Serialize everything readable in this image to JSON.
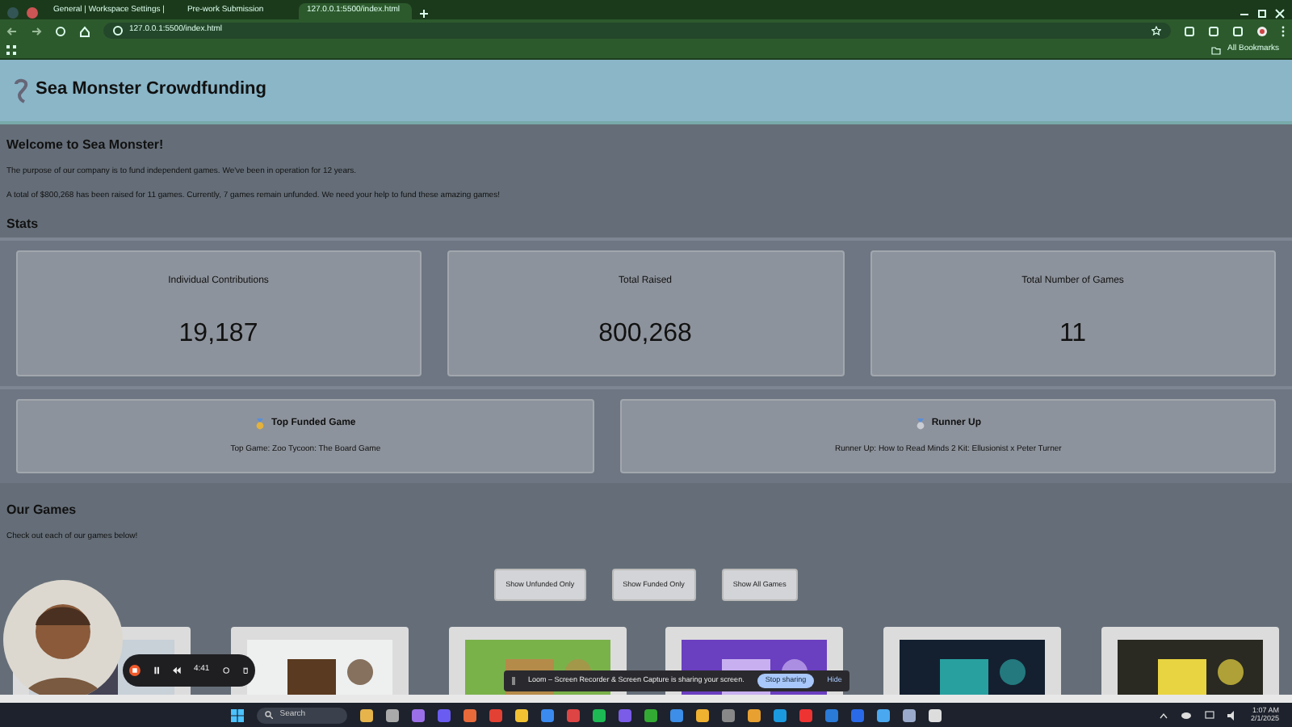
{
  "browser": {
    "tabs": [
      {
        "title": "General | Workspace Settings |",
        "selected": false
      },
      {
        "title": "Pre-work Submission",
        "selected": false
      },
      {
        "title": "127.0.0.1:5500/index.html",
        "selected": true
      }
    ],
    "address": "127.0.0.1:5500/index.html",
    "bookmarks": "All Bookmarks"
  },
  "page": {
    "title": "Sea Monster Crowdfunding",
    "welcome": "Welcome to Sea Monster!",
    "paragraphs": [
      "The purpose of our company is to fund independent games. We've been in operation for 12 years.",
      "A total of $800,268 has been raised for 11 games. Currently, 7 games remain unfunded. We need your help to fund these amazing games!"
    ],
    "stats_heading": "Stats",
    "stats": [
      {
        "label": "Individual Contributions",
        "value": "19,187"
      },
      {
        "label": "Total Raised",
        "value": "800,268"
      },
      {
        "label": "Total Number of Games",
        "value": "11"
      }
    ],
    "highlights": [
      {
        "label": "Top Funded Game",
        "text": "Top Game: Zoo Tycoon: The Board Game"
      },
      {
        "label": "Runner Up",
        "text": "Runner Up: How to Read Minds 2 Kit: Ellusionist x Peter Turner"
      }
    ],
    "games_heading": "Our Games",
    "games_text": "Check out each of our games below!",
    "buttons": [
      "Show Unfunded Only",
      "Show Funded Only",
      "Show All Games"
    ],
    "games": [
      {
        "kind": "picture"
      },
      {
        "kind": "picture"
      },
      {
        "kind": "picture"
      },
      {
        "kind": "picture"
      },
      {
        "kind": "picture"
      },
      {
        "kind": "picture"
      }
    ]
  },
  "loom": {
    "time": "4:41",
    "notice": "Loom – Screen Recorder & Screen Capture is sharing your screen.",
    "stop": "Stop sharing",
    "hide": "Hide"
  },
  "taskbar": {
    "search": "Search",
    "time": "1:07 AM",
    "date": "2/1/2025"
  }
}
